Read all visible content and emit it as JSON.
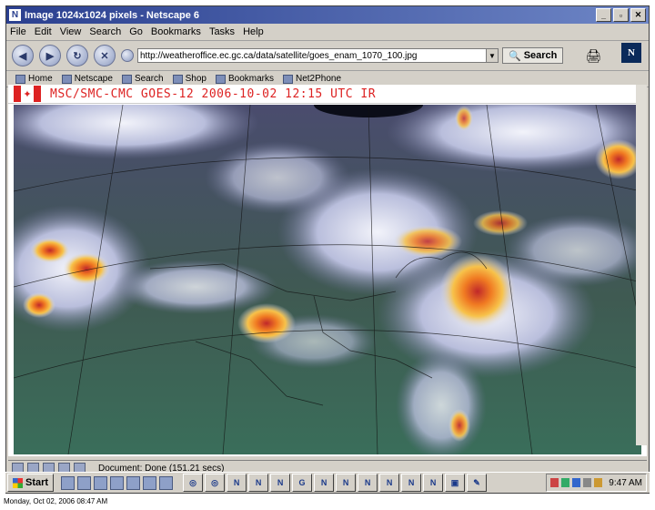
{
  "window": {
    "title": "Image 1024x1024 pixels - Netscape 6",
    "controls": [
      "_",
      "▫",
      "✕"
    ]
  },
  "menu": [
    "File",
    "Edit",
    "View",
    "Search",
    "Go",
    "Bookmarks",
    "Tasks",
    "Help"
  ],
  "nav": {
    "url": "http://weatheroffice.ec.gc.ca/data/satellite/goes_enam_1070_100.jpg",
    "search_label": "Search"
  },
  "bookmarks": [
    "Home",
    "Netscape",
    "Search",
    "Shop",
    "Bookmarks",
    "Net2Phone"
  ],
  "image": {
    "header_text": "MSC/SMC-CMC  GOES-12 2006-10-02 12:15 UTC  IR"
  },
  "status": {
    "text": "Document: Done (151.21 secs)"
  },
  "taskbar": {
    "start_label": "Start",
    "clock": "9:47 AM"
  },
  "footer_text": "Monday, Oct 02, 2006 08:47 AM"
}
